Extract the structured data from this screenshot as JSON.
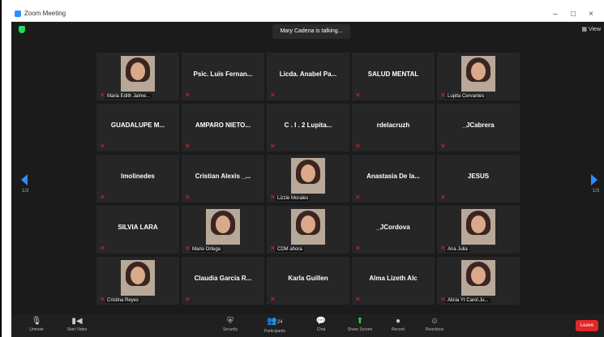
{
  "window": {
    "title": "Zoom Meeting",
    "minimize": "–",
    "maximize": "□",
    "close": "×"
  },
  "meeting": {
    "speaking_indicator": "Mary Cadena is talking...",
    "view_label": "View",
    "page_left": "1/3",
    "page_right": "1/3"
  },
  "tiles": [
    {
      "name": "",
      "label": "Maria Edith Jaime...",
      "photo": true
    },
    {
      "name": "Psic. Luis Fernan...",
      "label": "",
      "photo": false
    },
    {
      "name": "Licda. Anabel Pa...",
      "label": "",
      "photo": false
    },
    {
      "name": "SALUD MENTAL",
      "label": "",
      "photo": false
    },
    {
      "name": "",
      "label": "Lupita Cervantes",
      "photo": true
    },
    {
      "name": "GUADALUPE M...",
      "label": "",
      "photo": false
    },
    {
      "name": "AMPARO NIETO...",
      "label": "",
      "photo": false
    },
    {
      "name": "C . I . 2   Lupita...",
      "label": "",
      "photo": false
    },
    {
      "name": "rdelacruzh",
      "label": "",
      "photo": false
    },
    {
      "name": "_JCabrera",
      "label": "",
      "photo": false
    },
    {
      "name": "lmolinedes",
      "label": "",
      "photo": false
    },
    {
      "name": "Cristian Alexis _...",
      "label": "",
      "photo": false
    },
    {
      "name": "",
      "label": "Lizzie Morales",
      "photo": true
    },
    {
      "name": "Anastasia De la...",
      "label": "",
      "photo": false
    },
    {
      "name": "JESUS",
      "label": "",
      "photo": false
    },
    {
      "name": "SILVIA LARA",
      "label": "",
      "photo": false
    },
    {
      "name": "",
      "label": "Mario Ortega",
      "photo": true
    },
    {
      "name": "",
      "label": "CDM ahora",
      "photo": true
    },
    {
      "name": "_JCordova",
      "label": "",
      "photo": false
    },
    {
      "name": "",
      "label": "Ana Julia",
      "photo": true
    },
    {
      "name": "",
      "label": "Cristina Reyes",
      "photo": true
    },
    {
      "name": "Claudia Garcia R...",
      "label": "",
      "photo": false
    },
    {
      "name": "Karla Guillen",
      "label": "",
      "photo": false
    },
    {
      "name": "Alma Lizeth Alc",
      "label": "",
      "photo": false
    },
    {
      "name": "",
      "label": "Alicia Yt Carol.Ju...",
      "photo": true
    }
  ],
  "toolbar": {
    "unmute": "Unmute",
    "start_video": "Start Video",
    "security": "Security",
    "participants": "Participants",
    "participants_count": "24",
    "chat": "Chat",
    "share_screen": "Share Screen",
    "record": "Record",
    "reactions": "Reactions",
    "leave": "Leave"
  },
  "colors": {
    "accent": "#2d8cff",
    "tile_bg": "#262626",
    "background": "#1b1b1b",
    "muted_red": "#e02828",
    "share_green": "#23d959"
  }
}
